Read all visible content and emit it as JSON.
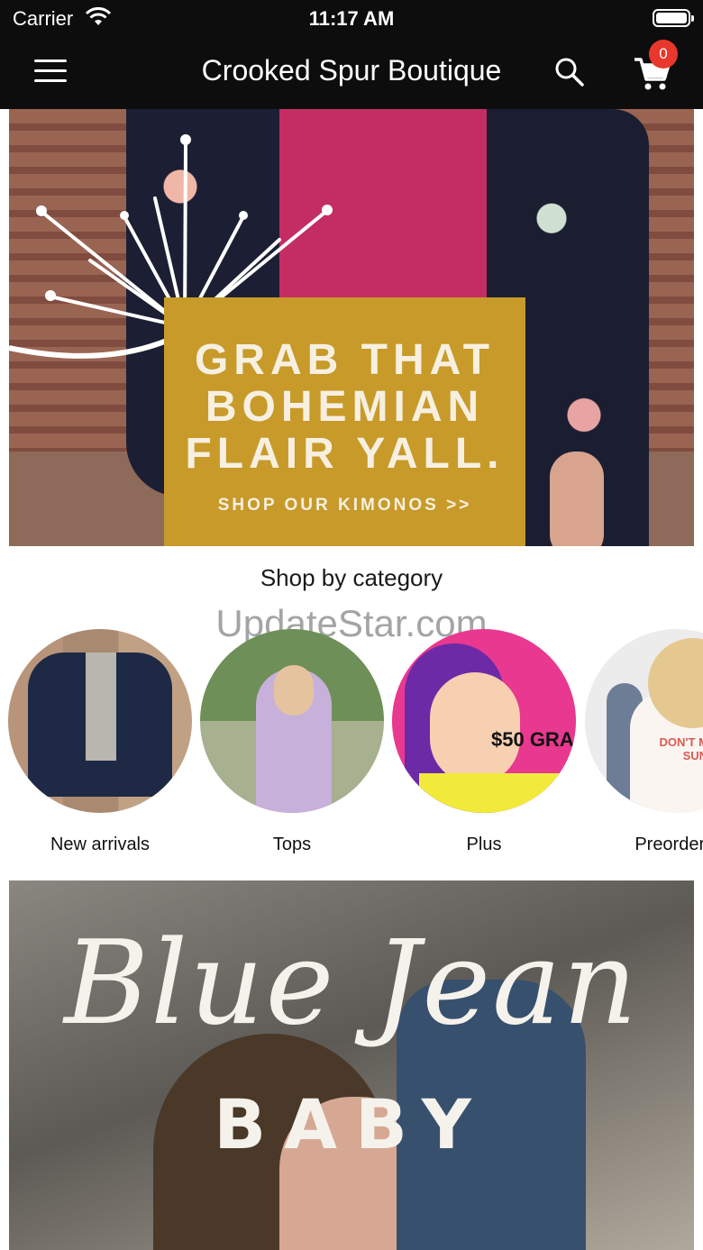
{
  "status_bar": {
    "carrier": "Carrier",
    "time": "11:17 AM"
  },
  "header": {
    "title": "Crooked Spur Boutique",
    "cart_count": "0",
    "icons": {
      "menu": "hamburger-menu-icon",
      "search": "search-icon",
      "cart": "shopping-cart-icon"
    }
  },
  "hero_banner": {
    "lines": [
      "GRAB THAT",
      "BOHEMIAN",
      "FLAIR YALL."
    ],
    "cta": "SHOP OUR KIMONOS >>",
    "box_color": "#c79a2a"
  },
  "categories": {
    "title": "Shop by category",
    "items": [
      {
        "label": "New arrivals",
        "image": "denim jacket"
      },
      {
        "label": "Tops",
        "image": "tie-dye top"
      },
      {
        "label": "Plus",
        "image": "pop-art woman",
        "sticker": "$50 GRA"
      },
      {
        "label": "Preorder it",
        "image": "graphic tee",
        "sticker": "DON'T MISS THE SUNSET"
      }
    ]
  },
  "watermark": "UpdateStar.com",
  "second_banner": {
    "script": "Blue Jean",
    "subtitle": "BABY"
  }
}
